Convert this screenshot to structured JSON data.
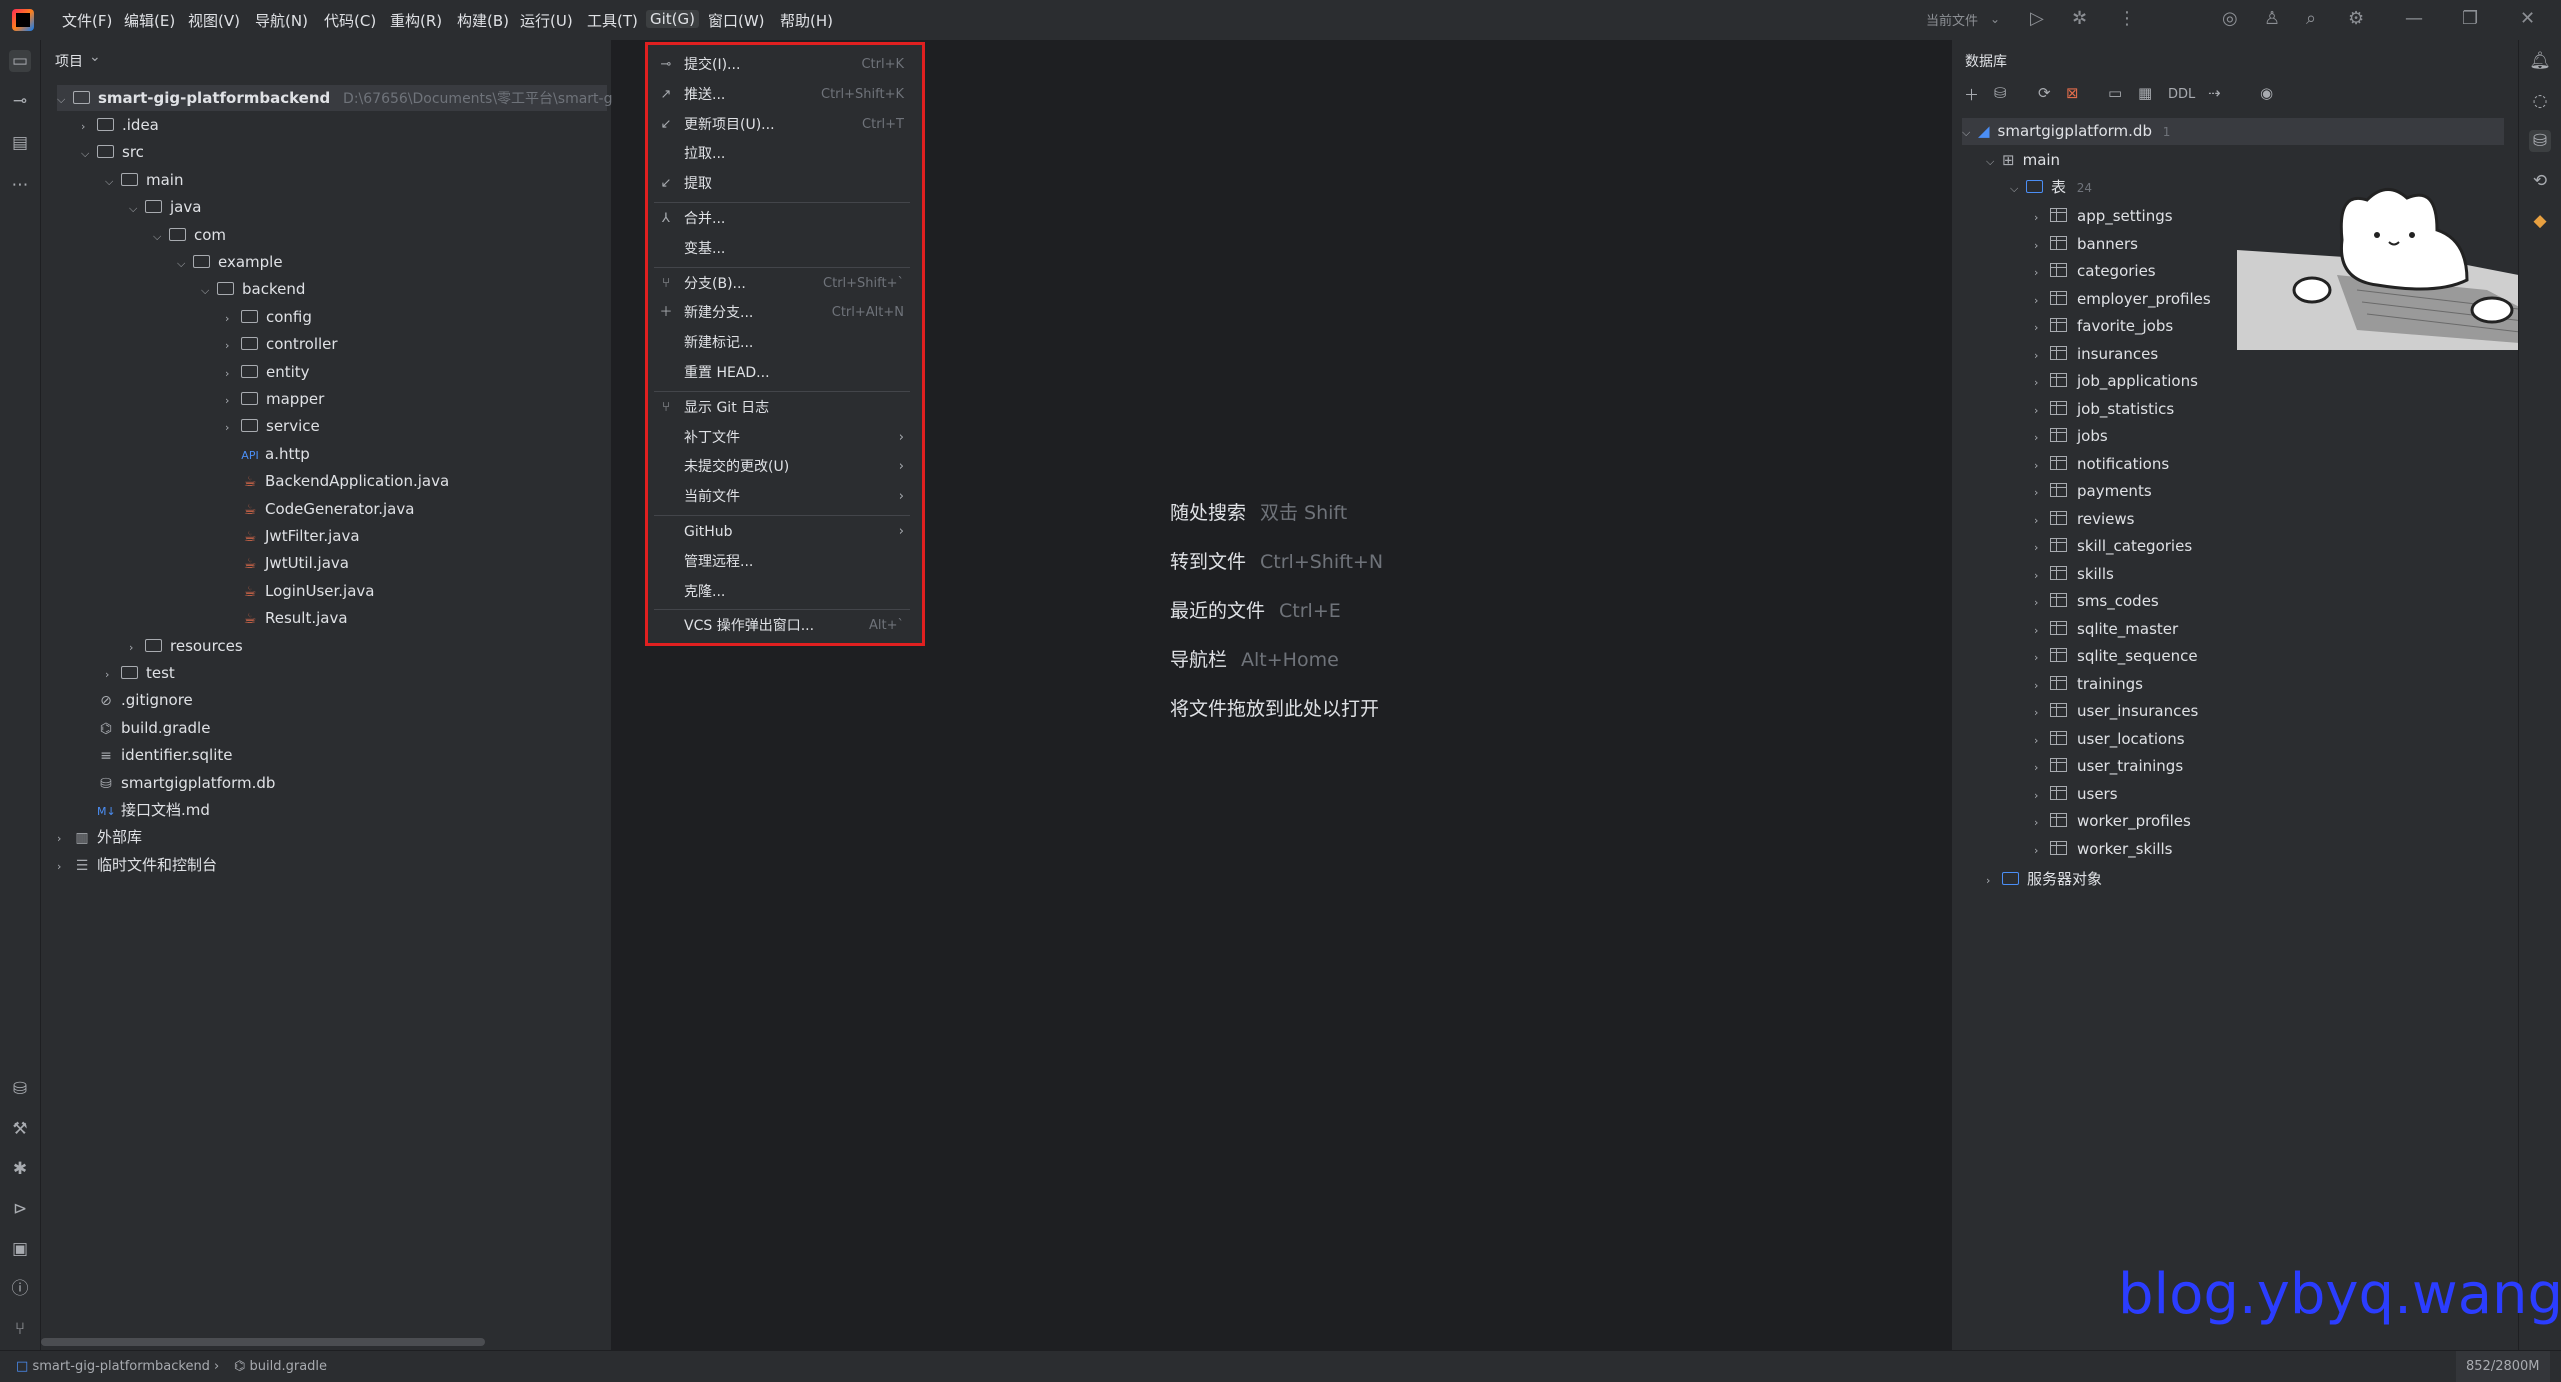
{
  "menubar": {
    "items": [
      "文件(F)",
      "编辑(E)",
      "视图(V)",
      "导航(N)",
      "代码(C)",
      "重构(R)",
      "构建(B)",
      "运行(U)",
      "工具(T)",
      "Git(G)",
      "窗口(W)",
      "帮助(H)"
    ],
    "active": "Git(G)",
    "current_file_label": "当前文件"
  },
  "project_panel": {
    "title": "项目",
    "root_name": "smart-gig-platformbackend",
    "root_path": "D:\\67656\\Documents\\零工平台\\smart-g",
    "tree": [
      {
        "label": ".idea",
        "type": "folder",
        "depth": 1,
        "expanded": false
      },
      {
        "label": "src",
        "type": "folder",
        "depth": 1,
        "expanded": true
      },
      {
        "label": "main",
        "type": "folder",
        "depth": 2,
        "expanded": true
      },
      {
        "label": "java",
        "type": "folder",
        "depth": 3,
        "expanded": true
      },
      {
        "label": "com",
        "type": "folder",
        "depth": 4,
        "expanded": true
      },
      {
        "label": "example",
        "type": "folder",
        "depth": 5,
        "expanded": true
      },
      {
        "label": "backend",
        "type": "folder",
        "depth": 6,
        "expanded": true
      },
      {
        "label": "config",
        "type": "folder",
        "depth": 7,
        "expanded": false
      },
      {
        "label": "controller",
        "type": "folder",
        "depth": 7,
        "expanded": false
      },
      {
        "label": "entity",
        "type": "folder",
        "depth": 7,
        "expanded": false
      },
      {
        "label": "mapper",
        "type": "folder",
        "depth": 7,
        "expanded": false
      },
      {
        "label": "service",
        "type": "folder",
        "depth": 7,
        "expanded": false
      },
      {
        "label": "a.http",
        "type": "http",
        "depth": 7
      },
      {
        "label": "BackendApplication.java",
        "type": "java",
        "depth": 7
      },
      {
        "label": "CodeGenerator.java",
        "type": "java",
        "depth": 7
      },
      {
        "label": "JwtFilter.java",
        "type": "java",
        "depth": 7
      },
      {
        "label": "JwtUtil.java",
        "type": "java",
        "depth": 7
      },
      {
        "label": "LoginUser.java",
        "type": "java",
        "depth": 7
      },
      {
        "label": "Result.java",
        "type": "java",
        "depth": 7
      },
      {
        "label": "resources",
        "type": "folder",
        "depth": 3,
        "expanded": false
      },
      {
        "label": "test",
        "type": "folder",
        "depth": 2,
        "expanded": false
      },
      {
        "label": ".gitignore",
        "type": "ignore",
        "depth": 1
      },
      {
        "label": "build.gradle",
        "type": "gradle",
        "depth": 1
      },
      {
        "label": "identifier.sqlite",
        "type": "text",
        "depth": 1
      },
      {
        "label": "smartgigplatform.db",
        "type": "db",
        "depth": 1
      },
      {
        "label": "接口文档.md",
        "type": "md",
        "depth": 1
      },
      {
        "label": "外部库",
        "type": "lib",
        "depth": 0,
        "expanded": false
      },
      {
        "label": "临时文件和控制台",
        "type": "scratch",
        "depth": 0,
        "expanded": false
      }
    ]
  },
  "git_menu": {
    "items": [
      {
        "label": "提交(I)...",
        "shortcut": "Ctrl+K",
        "icon": "commit-icon"
      },
      {
        "label": "推送...",
        "shortcut": "Ctrl+Shift+K",
        "icon": "push-icon"
      },
      {
        "label": "更新项目(U)...",
        "shortcut": "Ctrl+T",
        "icon": "update-icon"
      },
      {
        "label": "拉取...",
        "shortcut": "",
        "icon": ""
      },
      {
        "label": "提取",
        "shortcut": "",
        "icon": "fetch-icon"
      },
      {
        "sep": true
      },
      {
        "label": "合并...",
        "shortcut": "",
        "icon": "merge-icon"
      },
      {
        "label": "变基...",
        "shortcut": "",
        "icon": ""
      },
      {
        "sep": true
      },
      {
        "label": "分支(B)...",
        "shortcut": "Ctrl+Shift+`",
        "icon": "branch-icon"
      },
      {
        "label": "新建分支...",
        "shortcut": "Ctrl+Alt+N",
        "icon": "plus-icon"
      },
      {
        "label": "新建标记...",
        "shortcut": "",
        "icon": ""
      },
      {
        "label": "重置 HEAD...",
        "shortcut": "",
        "icon": ""
      },
      {
        "sep": true
      },
      {
        "label": "显示 Git 日志",
        "shortcut": "",
        "icon": "log-icon"
      },
      {
        "label": "补丁文件",
        "shortcut": "",
        "icon": "",
        "submenu": true
      },
      {
        "label": "未提交的更改(U)",
        "shortcut": "",
        "icon": "",
        "submenu": true
      },
      {
        "label": "当前文件",
        "shortcut": "",
        "icon": "",
        "submenu": true
      },
      {
        "sep": true
      },
      {
        "label": "GitHub",
        "shortcut": "",
        "icon": "",
        "submenu": true
      },
      {
        "label": "管理远程...",
        "shortcut": "",
        "icon": ""
      },
      {
        "label": "克隆...",
        "shortcut": "",
        "icon": ""
      },
      {
        "sep": true
      },
      {
        "label": "VCS 操作弹出窗口...",
        "shortcut": "Alt+`",
        "icon": ""
      }
    ]
  },
  "editor_hints": [
    {
      "label": "随处搜索",
      "key": "双击 Shift"
    },
    {
      "label": "转到文件",
      "key": "Ctrl+Shift+N"
    },
    {
      "label": "最近的文件",
      "key": "Ctrl+E"
    },
    {
      "label": "导航栏",
      "key": "Alt+Home"
    },
    {
      "label": "将文件拖放到此处以打开",
      "key": ""
    }
  ],
  "database_panel": {
    "title": "数据库",
    "ddl_label": "DDL",
    "datasource": "smartgigplatform.db",
    "datasource_count": "1",
    "schema": "main",
    "tables_label": "表",
    "tables_count": "24",
    "tables": [
      "app_settings",
      "banners",
      "categories",
      "employer_profiles",
      "favorite_jobs",
      "insurances",
      "job_applications",
      "job_statistics",
      "jobs",
      "notifications",
      "payments",
      "reviews",
      "skill_categories",
      "skills",
      "sms_codes",
      "sqlite_master",
      "sqlite_sequence",
      "trainings",
      "user_insurances",
      "user_locations",
      "user_trainings",
      "users",
      "worker_profiles",
      "worker_skills"
    ],
    "server_objects_label": "服务器对象"
  },
  "statusbar": {
    "breadcrumb_project": "smart-gig-platformbackend",
    "breadcrumb_file": "build.gradle",
    "memory": "852/2800M"
  },
  "watermark": "blog.ybyq.wang",
  "colors": {
    "accent_red": "#e02020",
    "watermark_blue": "#2b3dff"
  }
}
